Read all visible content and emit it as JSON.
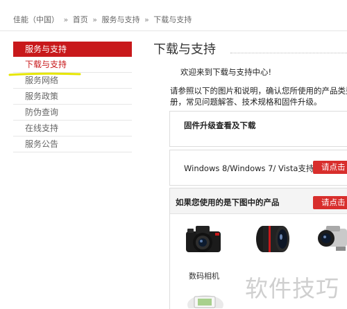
{
  "breadcrumb": {
    "items": [
      "佳能（中国）",
      "首页",
      "服务与支持",
      "下载与支持"
    ],
    "separator": "»"
  },
  "sidebar": {
    "header": "服务与支持",
    "items": [
      "下载与支持",
      "服务网络",
      "服务政策",
      "防伪查询",
      "在线支持",
      "服务公告"
    ],
    "active_index": 0
  },
  "main": {
    "title": "下载与支持",
    "welcome": "欢迎来到下载与支持中心!",
    "intro_line1": "请参照以下的图片和说明，确认您所使用的产品类型，",
    "intro_line2": "册，常见问题解答、技术规格和固件升级。",
    "firmware_box_title": "固件升级查看及下载",
    "os_box_title": "Windows 8/Windows 7/ Vista支持",
    "os_box_button": "请点击",
    "products_box_title": "如果您使用的是下图中的产品",
    "products_box_button": "请点击",
    "products": [
      {
        "label": "数码相机",
        "icon": "dslr-camera-icon"
      },
      {
        "label": "",
        "icon": "lens-icon"
      },
      {
        "label": "",
        "icon": "camcorder-icon"
      },
      {
        "label": "",
        "icon": "printer-icon"
      }
    ]
  },
  "watermark": "软件技巧",
  "colors": {
    "brand_red": "#c8191b",
    "button_red": "#d82e2c",
    "highlight_yellow": "#e6e600"
  }
}
